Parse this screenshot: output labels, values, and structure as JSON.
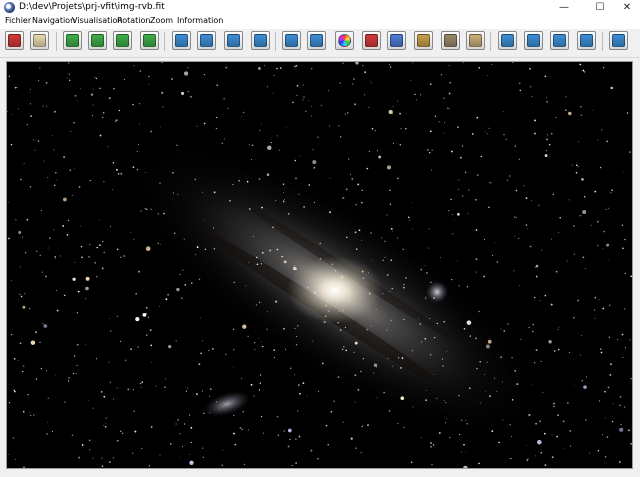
{
  "window": {
    "title": "D:\\dev\\Projets\\prj-vfit\\img-rvb.fit",
    "minimize_glyph": "—",
    "maximize_glyph": "☐",
    "close_glyph": "✕"
  },
  "menu": [
    "Fichier",
    "Navigation",
    "Visualisation",
    "Rotation",
    "Zoom",
    "Information"
  ],
  "toolbar": {
    "buttons": [
      {
        "icon": "power-icon",
        "color": "#d33a3a"
      },
      {
        "icon": "document-icon",
        "color": "#e8dcb0"
      },
      {
        "icon": "first-icon",
        "color": "#3fae4a"
      },
      {
        "icon": "previous-icon",
        "color": "#3fae4a"
      },
      {
        "icon": "next-icon",
        "color": "#3fae4a"
      },
      {
        "icon": "last-icon",
        "color": "#3fae4a"
      },
      {
        "icon": "zoom-in-icon",
        "color": "#3e8fd6"
      },
      {
        "icon": "zoom-out-icon",
        "color": "#3e8fd6"
      },
      {
        "icon": "zoom-fit-icon",
        "color": "#3e8fd6"
      },
      {
        "icon": "zoom-actual-icon",
        "color": "#3e8fd6"
      },
      {
        "icon": "channels-icon",
        "color": "#3e8fd6"
      },
      {
        "icon": "image-icon",
        "color": "#3e8fd6"
      },
      {
        "icon": "color-wheel-icon",
        "color": "#ff4d4d"
      },
      {
        "icon": "histogram-red-icon",
        "color": "#d33a3a"
      },
      {
        "icon": "histogram-rgb-icon",
        "color": "#4d7bd6"
      },
      {
        "icon": "histogram-edit-icon",
        "color": "#c9a14a"
      },
      {
        "icon": "save-icon",
        "color": "#9a8a6a"
      },
      {
        "icon": "export-icon",
        "color": "#c9b07a"
      },
      {
        "icon": "rotate-left-icon",
        "color": "#3e8fd6"
      },
      {
        "icon": "rotate-right-icon",
        "color": "#3e8fd6"
      },
      {
        "icon": "flip-vertical-icon",
        "color": "#3e8fd6"
      },
      {
        "icon": "flip-horizontal-icon",
        "color": "#3e8fd6"
      },
      {
        "icon": "info-icon",
        "color": "#3e8fd6"
      }
    ]
  },
  "viewer": {
    "image_kind": "galaxy-photograph",
    "background_color": "#000000"
  }
}
